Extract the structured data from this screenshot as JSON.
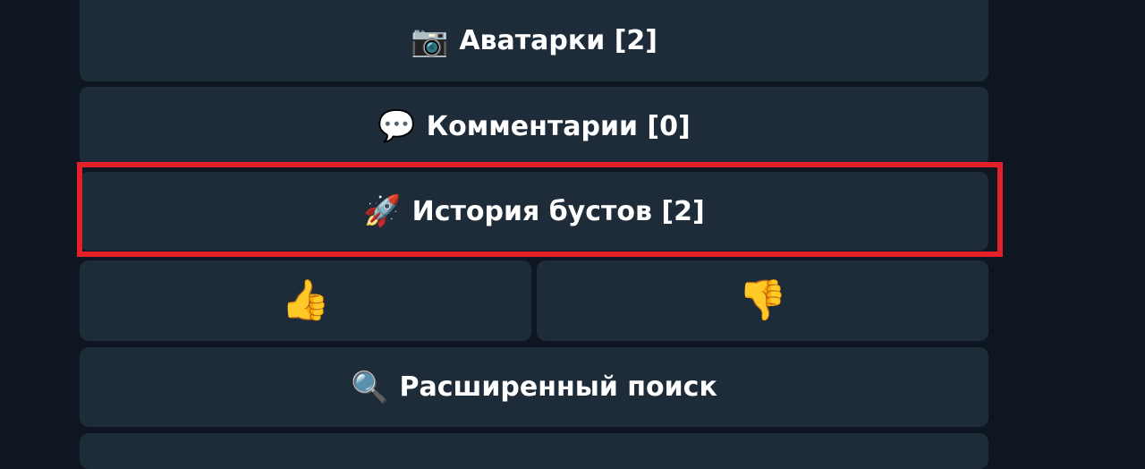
{
  "keyboard": {
    "avatars": {
      "icon": "camera-icon",
      "glyph": "📷",
      "label": "Аватарки [2]"
    },
    "comments": {
      "icon": "speech-bubble-icon",
      "glyph": "💬",
      "label": "Комментарии [0]"
    },
    "boost_history": {
      "icon": "rocket-icon",
      "glyph": "🚀",
      "label": "История бустов [2]"
    },
    "like": {
      "icon": "thumbs-up-icon",
      "glyph": "👍"
    },
    "dislike": {
      "icon": "thumbs-down-icon",
      "glyph": "👎"
    },
    "advanced_search": {
      "icon": "magnifier-icon",
      "glyph": "🔍",
      "label": "Расширенный поиск"
    }
  },
  "highlight": {
    "target": "boost-history-button",
    "color": "#e4202a"
  },
  "colors": {
    "background": "#0e1621",
    "button": "#1e2c3a",
    "text": "#ffffff"
  }
}
